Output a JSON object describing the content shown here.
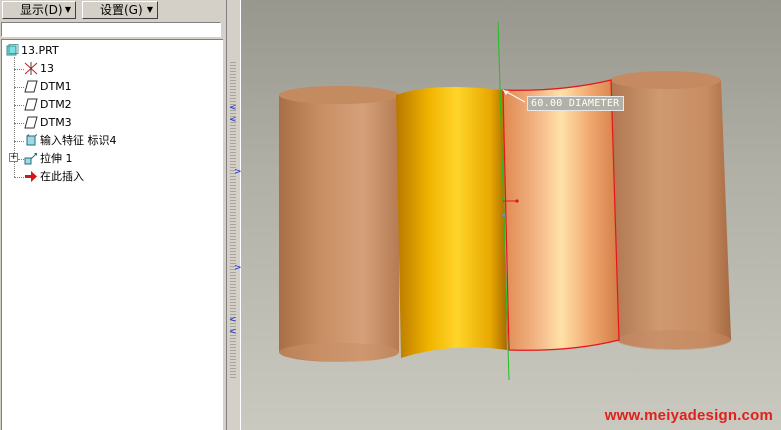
{
  "toolbar": {
    "show_menu": "显示(D)",
    "settings_menu": "设置(G)"
  },
  "tree": {
    "items": [
      {
        "label": "13.PRT",
        "icon": "part-icon"
      },
      {
        "label": "13",
        "icon": "csys-icon"
      },
      {
        "label": "DTM1",
        "icon": "datum-plane-icon"
      },
      {
        "label": "DTM2",
        "icon": "datum-plane-icon"
      },
      {
        "label": "DTM3",
        "icon": "datum-plane-icon"
      },
      {
        "label": "输入特征 标识4",
        "icon": "import-feature-icon"
      },
      {
        "label": "拉伸 1",
        "icon": "extrude-icon"
      },
      {
        "label": "在此插入",
        "icon": "insert-here-arrow-icon"
      }
    ]
  },
  "viewport": {
    "dimension_label": "60.00 DIAMETER",
    "watermark": "www.meiyadesign.com"
  },
  "colors": {
    "cylinder_copper": "#c8906a",
    "cylinder_yellow": "#f0b800",
    "highlight_edge": "#e8141c",
    "axis_green": "#20c020",
    "watermark": "#e0201c"
  }
}
